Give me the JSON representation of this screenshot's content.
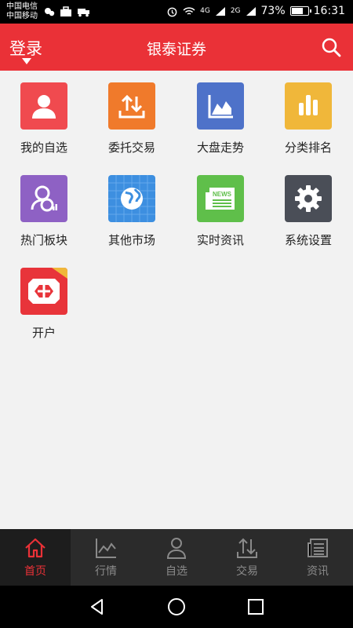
{
  "status_bar": {
    "carrier1": "中国电信",
    "carrier2": "中国移动",
    "net1": "4G",
    "net2": "2G",
    "battery_text": "73%",
    "battery_level": 0.73,
    "time": "16:31"
  },
  "header": {
    "login_label": "登录",
    "title": "银泰证券",
    "search_icon": "search-icon"
  },
  "tiles": [
    {
      "label": "我的自选",
      "icon": "person-icon",
      "color": "#f04a4f"
    },
    {
      "label": "委托交易",
      "icon": "trade-arrows-icon",
      "color": "#f07a2b"
    },
    {
      "label": "大盘走势",
      "icon": "area-chart-icon",
      "color": "#4e72c9"
    },
    {
      "label": "分类排名",
      "icon": "bar-chart-icon",
      "color": "#f0b73a"
    },
    {
      "label": "热门板块",
      "icon": "hot-sector-icon",
      "color": "#8e61c4"
    },
    {
      "label": "其他市场",
      "icon": "globe-icon",
      "color": "#3d8fe0"
    },
    {
      "label": "实时资讯",
      "icon": "news-icon",
      "color": "#5fbf4a",
      "badge": "NEWS"
    },
    {
      "label": "系统设置",
      "icon": "gear-icon",
      "color": "#4a4e57"
    },
    {
      "label": "开户",
      "icon": "open-account-icon",
      "color": "#e8343a"
    }
  ],
  "bottom_nav": [
    {
      "label": "首页",
      "icon": "home-icon",
      "active": true
    },
    {
      "label": "行情",
      "icon": "market-chart-icon",
      "active": false
    },
    {
      "label": "自选",
      "icon": "user-icon",
      "active": false
    },
    {
      "label": "交易",
      "icon": "exchange-icon",
      "active": false
    },
    {
      "label": "资讯",
      "icon": "newspaper-icon",
      "active": false
    }
  ],
  "colors": {
    "brand_red": "#ea3137",
    "nav_bg": "#2b2b2b",
    "nav_inactive": "#8a8a8a"
  }
}
